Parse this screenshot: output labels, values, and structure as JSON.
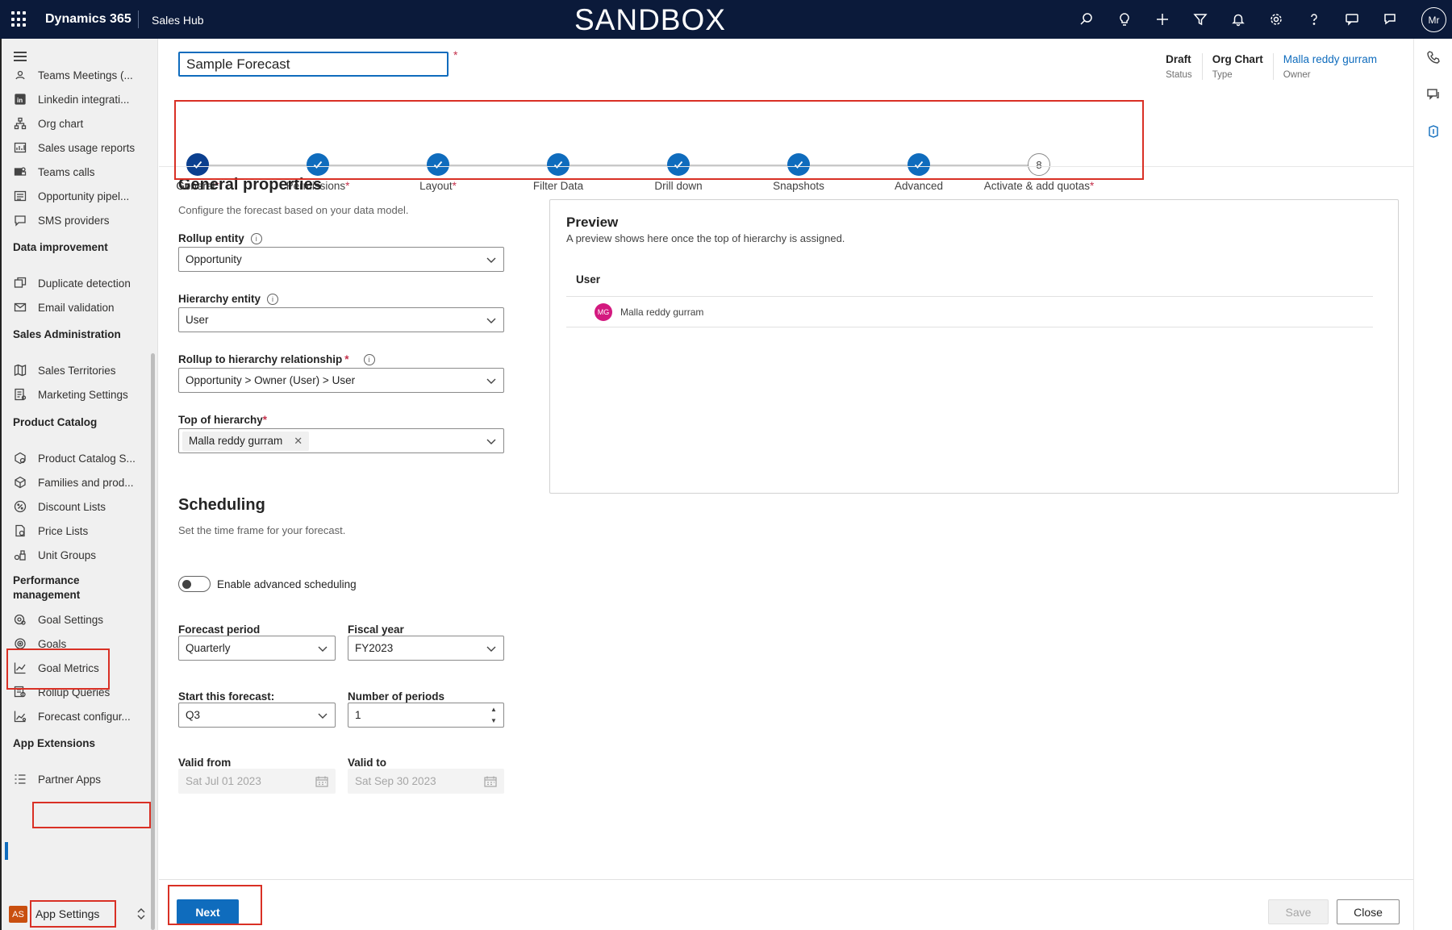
{
  "topbar": {
    "brand": "Dynamics 365",
    "app": "Sales Hub",
    "environment": "SANDBOX",
    "icons": [
      "search-icon",
      "lightbulb-icon",
      "add-icon",
      "filter-icon",
      "bell-icon",
      "gear-icon",
      "help-icon",
      "chat-icon",
      "feedback-icon"
    ],
    "user_initials": "Mr"
  },
  "leftnav": {
    "items_top": [
      {
        "label": "Teams Meetings (...",
        "icon": "teams-meetings-icon"
      },
      {
        "label": "Linkedin integrati...",
        "icon": "linkedin-icon"
      },
      {
        "label": "Org chart",
        "icon": "org-chart-icon"
      },
      {
        "label": "Sales usage reports",
        "icon": "reports-icon"
      },
      {
        "label": "Teams calls",
        "icon": "teams-icon"
      },
      {
        "label": "Opportunity pipel...",
        "icon": "pipeline-icon"
      },
      {
        "label": "SMS providers",
        "icon": "sms-icon"
      }
    ],
    "group_data_improvement": "Data improvement",
    "items_data": [
      {
        "label": "Duplicate detection",
        "icon": "duplicate-icon"
      },
      {
        "label": "Email validation",
        "icon": "email-icon"
      }
    ],
    "group_sales_admin": "Sales Administration",
    "items_sales": [
      {
        "label": "Sales Territories",
        "icon": "map-icon"
      },
      {
        "label": "Marketing Settings",
        "icon": "marketing-icon"
      }
    ],
    "group_product": "Product Catalog",
    "items_product": [
      {
        "label": "Product Catalog S...",
        "icon": "catalog-icon"
      },
      {
        "label": "Families and prod...",
        "icon": "box-icon"
      },
      {
        "label": "Discount Lists",
        "icon": "discount-icon"
      },
      {
        "label": "Price Lists",
        "icon": "price-list-icon"
      },
      {
        "label": "Unit Groups",
        "icon": "unit-groups-icon"
      }
    ],
    "group_performance_line1": "Performance",
    "group_performance_line2": "management",
    "items_perf": [
      {
        "label": "Goal Settings",
        "icon": "goal-settings-icon"
      },
      {
        "label": "Goals",
        "icon": "goal-icon"
      },
      {
        "label": "Goal Metrics",
        "icon": "metrics-icon"
      },
      {
        "label": "Rollup Queries",
        "icon": "query-icon"
      },
      {
        "label": "Forecast configur...",
        "icon": "forecast-icon"
      }
    ],
    "group_extensions": "App Extensions",
    "items_ext": [
      {
        "label": "Partner Apps",
        "icon": "partner-apps-icon"
      }
    ],
    "area_badge": "AS",
    "area_label": "App Settings"
  },
  "header": {
    "title_value": "Sample Forecast",
    "required_mark": "*",
    "status_value": "Draft",
    "status_label": "Status",
    "type_value": "Org Chart",
    "type_label": "Type",
    "owner_value": "Malla reddy gurram",
    "owner_label": "Owner"
  },
  "steps": [
    {
      "label": "General",
      "required": true,
      "state": "current"
    },
    {
      "label": "Permissions",
      "required": true,
      "state": "done"
    },
    {
      "label": "Layout",
      "required": true,
      "state": "done"
    },
    {
      "label": "Filter Data",
      "required": false,
      "state": "done"
    },
    {
      "label": "Drill down",
      "required": false,
      "state": "done"
    },
    {
      "label": "Snapshots",
      "required": false,
      "state": "done"
    },
    {
      "label": "Advanced",
      "required": false,
      "state": "done"
    },
    {
      "label": "Activate & add quotas",
      "required": true,
      "state": "todo",
      "number": "8"
    }
  ],
  "general": {
    "title": "General properties",
    "description": "Configure the forecast based on your data model.",
    "rollup_entity_label": "Rollup entity",
    "rollup_entity_value": "Opportunity",
    "hierarchy_entity_label": "Hierarchy entity",
    "hierarchy_entity_value": "User",
    "relationship_label": "Rollup to hierarchy relationship",
    "relationship_value": "Opportunity > Owner (User) > User",
    "top_label": "Top of hierarchy",
    "top_value": "Malla reddy gurram"
  },
  "scheduling": {
    "title": "Scheduling",
    "description": "Set the time frame for your forecast.",
    "toggle_label": "Enable advanced scheduling",
    "period_label": "Forecast period",
    "period_value": "Quarterly",
    "fiscal_label": "Fiscal year",
    "fiscal_value": "FY2023",
    "start_label": "Start this forecast:",
    "start_value": "Q3",
    "num_label": "Number of periods",
    "num_value": "1",
    "valid_from_label": "Valid from",
    "valid_from_value": "Sat Jul 01 2023",
    "valid_to_label": "Valid to",
    "valid_to_value": "Sat Sep 30 2023"
  },
  "preview": {
    "title": "Preview",
    "description": "A preview shows here once the top of hierarchy is assigned.",
    "column": "User",
    "row_initials": "MG",
    "row_name": "Malla reddy gurram"
  },
  "footer": {
    "next": "Next",
    "save": "Save",
    "close": "Close"
  },
  "colors": {
    "brand_bar": "#0b1a3a",
    "primary": "#0f6cbd",
    "annotation": "#d93025"
  }
}
